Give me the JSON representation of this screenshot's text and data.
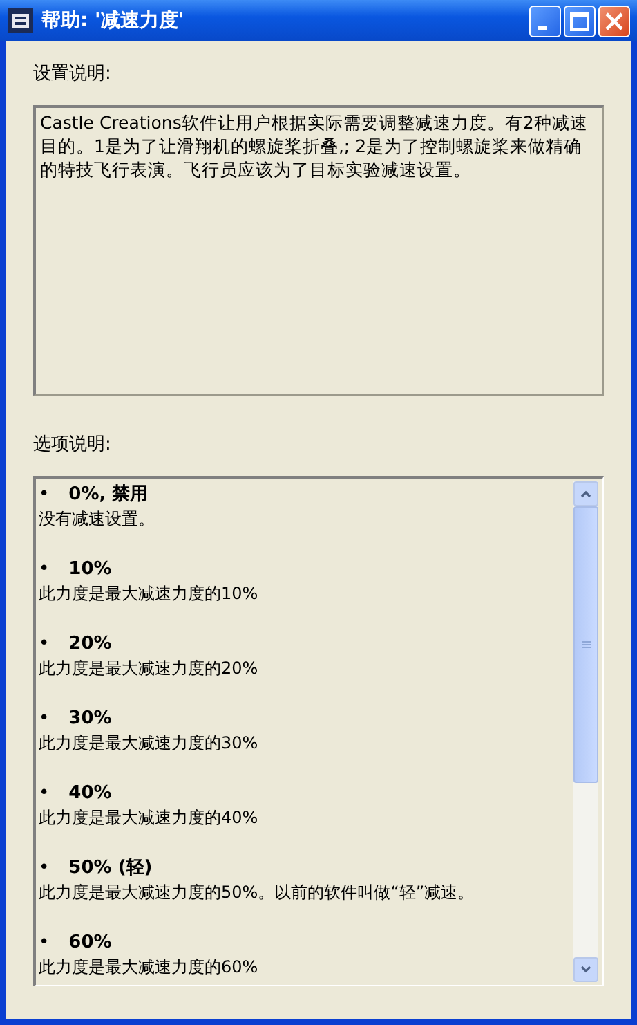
{
  "window": {
    "title": "帮助: '减速力度'"
  },
  "settings": {
    "label": "设置说明:",
    "text": "Castle Creations软件让用户根据实际需要调整减速力度。有2种减速目的。1是为了让滑翔机的螺旋桨折叠,; 2是为了控制螺旋桨来做精确的特技飞行表演。飞行员应该为了目标实验减速设置。"
  },
  "options": {
    "label": "选项说明:",
    "items": [
      {
        "bullet": "•",
        "title": "0%, 禁用",
        "description": "没有减速设置。"
      },
      {
        "bullet": "•",
        "title": "10%",
        "description": "此力度是最大减速力度的10%"
      },
      {
        "bullet": "•",
        "title": "20%",
        "description": "此力度是最大减速力度的20%"
      },
      {
        "bullet": "•",
        "title": "30%",
        "description": "此力度是最大减速力度的30%"
      },
      {
        "bullet": "•",
        "title": "40%",
        "description": "此力度是最大减速力度的40%"
      },
      {
        "bullet": "•",
        "title": "50% (轻)",
        "description": "此力度是最大减速力度的50%。以前的软件叫做“轻”减速。"
      },
      {
        "bullet": "•",
        "title": "60%",
        "description": "此力度是最大减速力度的60%"
      }
    ]
  }
}
